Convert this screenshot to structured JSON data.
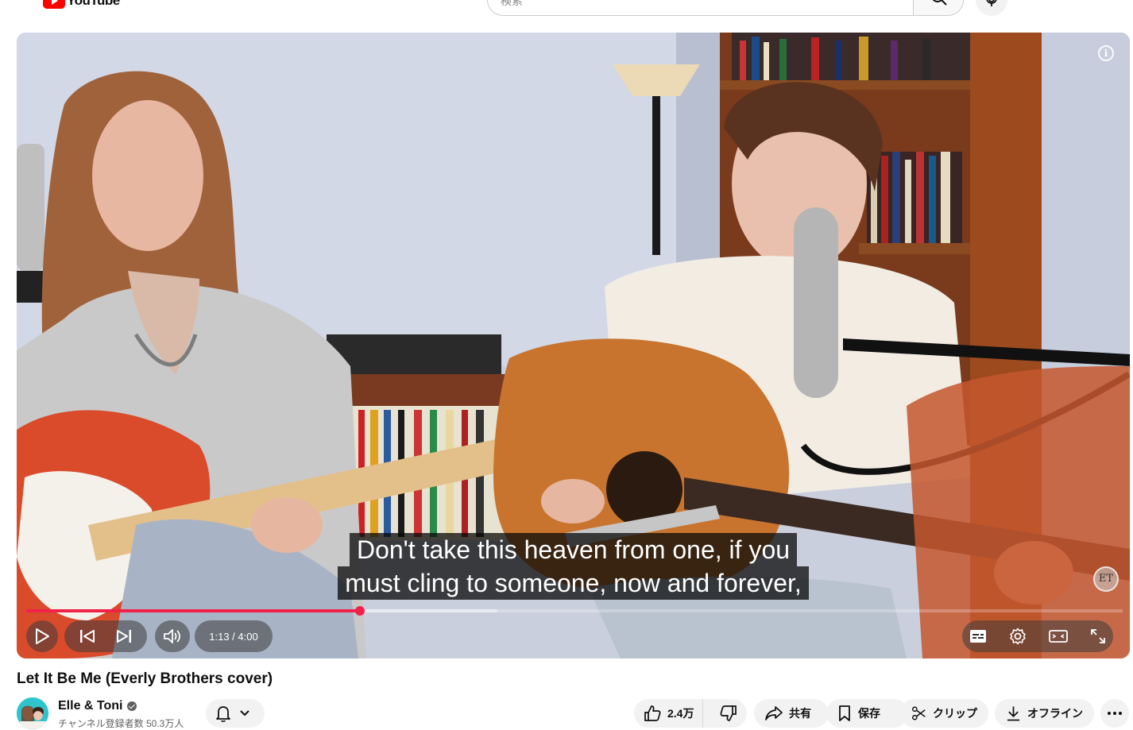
{
  "masthead": {
    "logo_text": "YouTube",
    "search_placeholder": "検索"
  },
  "player": {
    "captions": [
      "Don't take this heaven from one, if you",
      "must cling to someone, now and forever,"
    ],
    "time_display": "1:13 / 4:00",
    "progress_fraction": 0.304,
    "buffered_fraction": 0.43,
    "info_icon": "i",
    "watermark": "ET"
  },
  "video": {
    "title": "Let It Be Me (Everly Brothers cover)"
  },
  "channel": {
    "name": "Elle & Toni",
    "subscribers": "チャンネル登録者数 50.3万人"
  },
  "actions": {
    "like_count": "2.4万",
    "share": "共有",
    "save": "保存",
    "clip": "クリップ",
    "offline": "オフライン"
  }
}
